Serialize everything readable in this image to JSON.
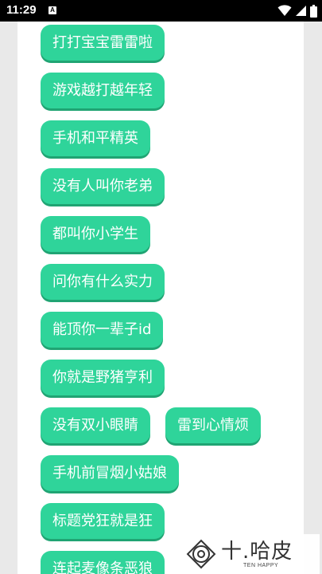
{
  "status_bar": {
    "time": "11:29",
    "notification_icon": "A"
  },
  "chips": [
    {
      "label": "打打宝宝雷雷啦"
    },
    {
      "label": "游戏越打越年轻"
    },
    {
      "label": "手机和平精英"
    },
    {
      "label": "没有人叫你老弟"
    },
    {
      "label": "都叫你小学生"
    },
    {
      "label": "问你有什么实力"
    },
    {
      "label": "能顶你一辈子id"
    },
    {
      "label": "你就是野猪亨利"
    },
    {
      "label": "没有双小眼睛"
    },
    {
      "label": "雷到心情烦"
    },
    {
      "label": "手机前冒烟小姑娘"
    },
    {
      "label": "标题党狂就是狂"
    },
    {
      "label": "连起麦像条恶狼"
    }
  ],
  "watermark": {
    "title": "十.哈皮",
    "subtitle": "TEN HAPPY"
  },
  "colors": {
    "chip_background": "#2fd49a",
    "chip_shadow": "#20a473",
    "panel": "#ffffff",
    "page_background": "#e9e9e9"
  }
}
